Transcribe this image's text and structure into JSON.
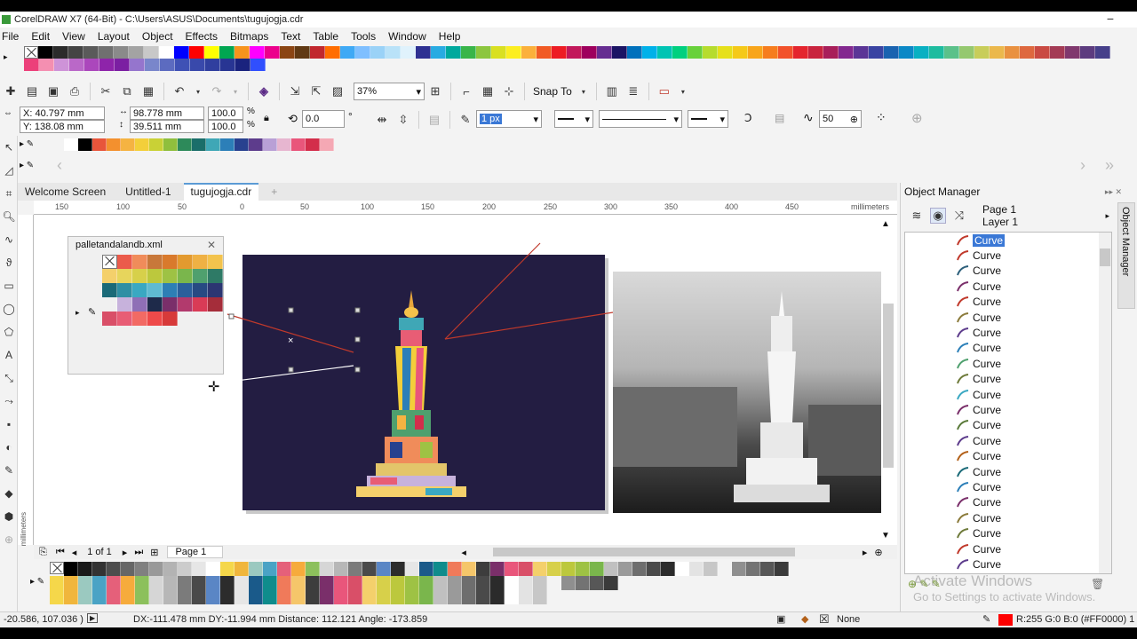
{
  "window": {
    "title": "CorelDRAW X7 (64-Bit) - C:\\Users\\ASUS\\Documents\\tugujogja.cdr",
    "minimize": "−"
  },
  "menu": [
    "File",
    "Edit",
    "View",
    "Layout",
    "Object",
    "Effects",
    "Bitmaps",
    "Text",
    "Table",
    "Tools",
    "Window",
    "Help"
  ],
  "top_palette": {
    "row1": [
      "#000000",
      "#2b2b2b",
      "#444444",
      "#5a5a5a",
      "#707070",
      "#8a8a8a",
      "#a3a3a3",
      "#c8c8c8",
      "#ffffff",
      "#0000ff",
      "#ff0000",
      "#ffff00",
      "#00a651",
      "#f7941d",
      "#ff00ff",
      "#ec008c",
      "#8b4513",
      "#603913",
      "#c1272d",
      "#ff6d00",
      "#3fa9f5",
      "#7fbfff",
      "#9ad2f7",
      "#b9e2f8",
      "#e0f2fc",
      "#2e3192",
      "#29abe2",
      "#00a99d",
      "#39b54a",
      "#8cc63f",
      "#d9e021",
      "#fcee21",
      "#fbb03b",
      "#f15a24",
      "#ed1c24",
      "#c2185b",
      "#9e005d",
      "#662d91",
      "#1b1464",
      "#0071bc",
      "#00b1e9",
      "#00c4b3",
      "#00d07f",
      "#68d13b",
      "#b6dc2e",
      "#e6e01a",
      "#f5c918",
      "#f8a51a",
      "#f67d1e",
      "#f2522b",
      "#e4252e",
      "#c9243e",
      "#a81f5a",
      "#83288f",
      "#5b3596",
      "#3a44a2",
      "#1a63b0",
      "#0b88c6",
      "#09b0c2",
      "#1ebc9f",
      "#5bc18a",
      "#95c86f",
      "#c8cd5a",
      "#ebb84c",
      "#e99140",
      "#de683f",
      "#c94a43",
      "#a43b55",
      "#80396e",
      "#5d3c7f",
      "#46408a"
    ],
    "row2": [
      "#ec407a",
      "#f48fb1",
      "#ce93d8",
      "#ba68c8",
      "#ab47bc",
      "#8e24aa",
      "#7b1fa2",
      "#9575cd",
      "#7986cb",
      "#5c6bc0",
      "#3f51b5",
      "#3949ab",
      "#303f9f",
      "#283593",
      "#1a237e",
      "#304ffe"
    ]
  },
  "toolbar1": {
    "zoom": "37%",
    "snap": "Snap To"
  },
  "propbar": {
    "x": "X: 40.797 mm",
    "y": "Y: 138.08 mm",
    "w": "98.778 mm",
    "h": "39.511 mm",
    "sx": "100.0",
    "sy": "100.0",
    "pct": "%",
    "angle": "0.0",
    "deg": "°",
    "outline": "1 px",
    "smooth": "50"
  },
  "doc_palette": [
    "#ffffff",
    "#000000",
    "#e8553b",
    "#f3902e",
    "#f5b342",
    "#f3cf3a",
    "#c9d136",
    "#8fbf3d",
    "#2d8a5a",
    "#1a6e6a",
    "#3fa7b6",
    "#2c7fb8",
    "#28418f",
    "#5d3c8c",
    "#b9a0d6",
    "#e7b6d0",
    "#e9567b",
    "#d32e4b",
    "#f5a8b4"
  ],
  "tabs": [
    "Welcome Screen",
    "Untitled-1",
    "tugujogja.cdr"
  ],
  "ruler": {
    "ticks": [
      "150",
      "100",
      "50",
      "0",
      "50",
      "100",
      "150",
      "200",
      "250",
      "300",
      "350",
      "400",
      "450"
    ],
    "unit": "millimeters",
    "vunit": "millimeters"
  },
  "palette_window": {
    "title": "palletandalandb.xml",
    "colors": [
      "#eb5b4b",
      "#f08c5a",
      "#c8783a",
      "#d97a2c",
      "#e39a2f",
      "#efb144",
      "#f3c34d",
      "#f4d06b",
      "#e7d55c",
      "#d7d04a",
      "#bcc83d",
      "#9ec244",
      "#7ab64c",
      "#4fa06e",
      "#2e7a66",
      "#1b6a78",
      "#2f8fa4",
      "#3aa8c2",
      "#5fbad1",
      "#2d7fb5",
      "#2a5f9b",
      "#274a83",
      "#2c3672",
      "#f0f0f0",
      "#c7b2dc",
      "#8f6fb6",
      "#1e2a4a",
      "#7a2f6a",
      "#b23a6d",
      "#d93b56",
      "#a52d3a",
      "#d94f68",
      "#e85d75",
      "#f26a64",
      "#ee4a4a",
      "#d73a3a"
    ]
  },
  "statusbar": {
    "coords": "-20.586, 107.036 )",
    "info": "DX:-111.478 mm DY:-11.994 mm Distance: 112.121 Angle: -173.859",
    "fill": "None",
    "color": "R:255 G:0 B:0 (#FF0000) 1 p"
  },
  "pagenav": {
    "count": "1 of 1",
    "page": "Page 1"
  },
  "docker": {
    "title": "Object Manager",
    "page": "Page 1",
    "layer": "Layer 1",
    "side": "Object Manager",
    "item": "Curve",
    "count": 22
  },
  "watermark": {
    "line1": "Activate Windows",
    "line2": "Go to Settings to activate Windows."
  },
  "bottom_palette": {
    "row1": [
      "#000000",
      "#1a1a1a",
      "#333333",
      "#4d4d4d",
      "#666666",
      "#808080",
      "#999999",
      "#b3b3b3",
      "#cccccc",
      "#e6e6e6",
      "#ffffff"
    ],
    "row2": [
      "#f5d74a",
      "#f0b63c",
      "#9bc9c0",
      "#4aa3c5",
      "#e5607a",
      "#f6ab3c",
      "#8cc05c",
      "#d6d6d6",
      "#b7b7b7",
      "#7b7b7b",
      "#4a4a4a",
      "#5a86c5",
      "#2c2c2c",
      "#e6e6e6",
      "#1a5a8a",
      "#0f8c8c",
      "#f07a5a",
      "#f5c66a",
      "#3d3d3d",
      "#7a2f6a",
      "#e9567b",
      "#d94f68",
      "#f4d06b",
      "#d7d04a",
      "#bcc83d",
      "#9ec244",
      "#7ab64c",
      "#c0c0c0",
      "#9a9a9a",
      "#6e6e6e",
      "#4a4a4a",
      "#2b2b2b",
      "#ffffff",
      "#e3e3e3",
      "#c7c7c7",
      "#abababa",
      "#8f8f8f",
      "#737373",
      "#575757",
      "#3b3b3b"
    ]
  }
}
